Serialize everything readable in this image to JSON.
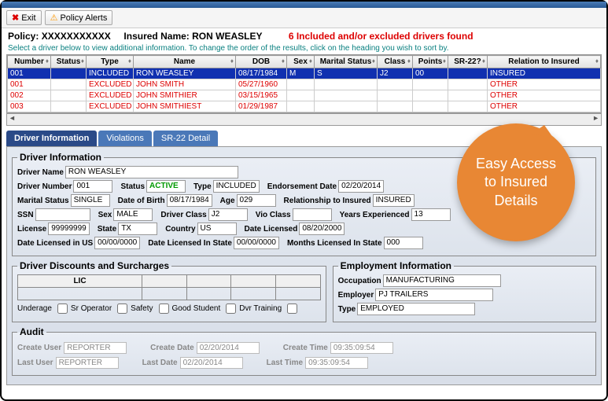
{
  "toolbar": {
    "exit": "Exit",
    "alerts": "Policy Alerts"
  },
  "header": {
    "policy_lbl": "Policy:",
    "policy_num": "XXXXXXXXXXX",
    "insured_lbl": "Insured Name:",
    "insured_name": "RON WEASLEY",
    "msg": "6 Included and/or excluded drivers found",
    "hint": "Select a driver below to view additional information. To change the order of the results, click on the heading you wish to sort by."
  },
  "grid": {
    "cols": [
      "Number",
      "Status",
      "Type",
      "Name",
      "DOB",
      "Sex",
      "Marital Status",
      "Class",
      "Points",
      "SR-22?",
      "Relation to Insured"
    ],
    "rows": [
      {
        "sel": true,
        "excl": false,
        "c": [
          "001",
          "",
          "INCLUDED",
          "RON WEASLEY",
          "08/17/1984",
          "M",
          "S",
          "J2",
          "00",
          "",
          "INSURED"
        ]
      },
      {
        "sel": false,
        "excl": true,
        "c": [
          "001",
          "",
          "EXCLUDED",
          "JOHN SMITH",
          "05/27/1960",
          "",
          "",
          "",
          "",
          "",
          "OTHER"
        ]
      },
      {
        "sel": false,
        "excl": true,
        "c": [
          "002",
          "",
          "EXCLUDED",
          "JOHN SMITHIER",
          "03/15/1965",
          "",
          "",
          "",
          "",
          "",
          "OTHER"
        ]
      },
      {
        "sel": false,
        "excl": true,
        "c": [
          "003",
          "",
          "EXCLUDED",
          "JOHN SMITHIEST",
          "01/29/1987",
          "",
          "",
          "",
          "",
          "",
          "OTHER"
        ]
      }
    ]
  },
  "tabs": [
    "Driver Information",
    "Violations",
    "SR-22 Detail"
  ],
  "driver": {
    "legend": "Driver Information",
    "name_l": "Driver Name",
    "name": "RON WEASLEY",
    "num_l": "Driver Number",
    "num": "001",
    "status_l": "Status",
    "status": "ACTIVE",
    "type_l": "Type",
    "type": "INCLUDED",
    "end_l": "Endorsement Date",
    "end": "02/20/2014",
    "ms_l": "Marital Status",
    "ms": "SINGLE",
    "dob_l": "Date of Birth",
    "dob": "08/17/1984",
    "age_l": "Age",
    "age": "029",
    "rel_l": "Relationship to Insured",
    "rel": "INSURED",
    "ssn_l": "SSN",
    "ssn": "",
    "sex_l": "Sex",
    "sex": "MALE",
    "dclass_l": "Driver Class",
    "dclass": "J2",
    "vclass_l": "Vio Class",
    "vclass": "",
    "yexp_l": "Years Experienced",
    "yexp": "13",
    "lic_l": "License",
    "lic": "99999999",
    "state_l": "State",
    "state": "TX",
    "country_l": "Country",
    "country": "US",
    "dlic_l": "Date Licensed",
    "dlic": "08/20/2000",
    "dlus_l": "Date Licensed in US",
    "dlus": "00/00/0000",
    "dlst_l": "Date Licensed In State",
    "dlst": "00/00/0000",
    "mlst_l": "Months Licensed In State",
    "mlst": "000"
  },
  "surcharges": {
    "legend": "Driver Discounts and Surcharges",
    "col": "LIC",
    "checks": [
      "Underage",
      "Sr Operator",
      "Safety",
      "Good Student",
      "Dvr Training"
    ]
  },
  "employment": {
    "legend": "Employment Information",
    "occ_l": "Occupation",
    "occ": "MANUFACTURING",
    "emp_l": "Employer",
    "emp": "PJ TRAILERS",
    "type_l": "Type",
    "type": "EMPLOYED"
  },
  "audit": {
    "legend": "Audit",
    "cuser_l": "Create User",
    "cuser": "REPORTER",
    "cdate_l": "Create Date",
    "cdate": "02/20/2014",
    "ctime_l": "Create Time",
    "ctime": "09:35:09:54",
    "luser_l": "Last User",
    "luser": "REPORTER",
    "ldate_l": "Last Date",
    "ldate": "02/20/2014",
    "ltime_l": "Last Time",
    "ltime": "09:35:09:54"
  },
  "callout": "Easy Access to Insured Details"
}
